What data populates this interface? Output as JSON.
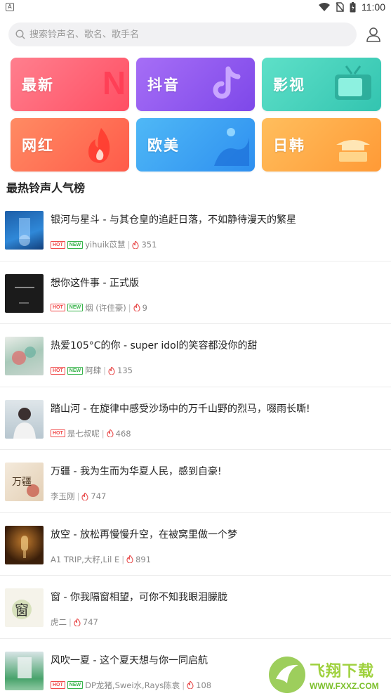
{
  "status_bar": {
    "app_badge": "A",
    "time": "11:00"
  },
  "search": {
    "placeholder": "搜索铃声名、歌名、歌手名"
  },
  "categories": [
    {
      "label": "最新",
      "deco": "N"
    },
    {
      "label": "抖音",
      "deco": "tiktok-icon"
    },
    {
      "label": "影视",
      "deco": "tv-icon"
    },
    {
      "label": "网红",
      "deco": "flame-icon"
    },
    {
      "label": "欧美",
      "deco": "wave-icon"
    },
    {
      "label": "日韩",
      "deco": "temple-icon"
    }
  ],
  "section_title": "最热铃声人气榜",
  "songs": [
    {
      "title": "银河与星斗 - 与其仓皇的追赶日落，不如静待漫天的繁星",
      "hot": true,
      "new": true,
      "artist": "yihuik苡慧",
      "plays": "351"
    },
    {
      "title": "想你这件事 - 正式版",
      "hot": true,
      "new": true,
      "artist": "烟 (许佳豪)",
      "plays": "9"
    },
    {
      "title": "热爱105°C的你 - super idol的笑容都没你的甜",
      "hot": true,
      "new": true,
      "artist": "阿肆",
      "plays": "135"
    },
    {
      "title": "踏山河 - 在旋律中感受沙场中的万千山野的烈马，啜雨长嘶!",
      "hot": true,
      "new": false,
      "artist": "是七叔呢",
      "plays": "468"
    },
    {
      "title": "万疆 - 我为生而为华夏人民，感到自豪!",
      "hot": false,
      "new": false,
      "artist": "李玉刚",
      "plays": "747"
    },
    {
      "title": "放空 - 放松再慢慢升空，在被窝里做一个梦",
      "hot": false,
      "new": false,
      "artist": "A1 TRIP,大籽,Lil E",
      "plays": "891"
    },
    {
      "title": "窗 - 你我隔窗相望，可你不知我眼泪朦胧",
      "hot": false,
      "new": false,
      "artist": "虎二",
      "plays": "747"
    },
    {
      "title": "风吹一夏 - 这个夏天想与你一同启航",
      "hot": true,
      "new": true,
      "artist": "DP龙猪,Swei水,Rays陈袁",
      "plays": "108"
    }
  ],
  "thumb_text": {
    "t5": "万疆",
    "t7": "窗"
  },
  "tags": {
    "hot": "HOT",
    "new": "NEW"
  },
  "watermark": {
    "cn": "飞翔下载",
    "url": "WWW.FXXZ.COM"
  },
  "colors": {
    "hot": "#f04a4a",
    "new": "#37b34a",
    "fire": "#e84b4b"
  }
}
